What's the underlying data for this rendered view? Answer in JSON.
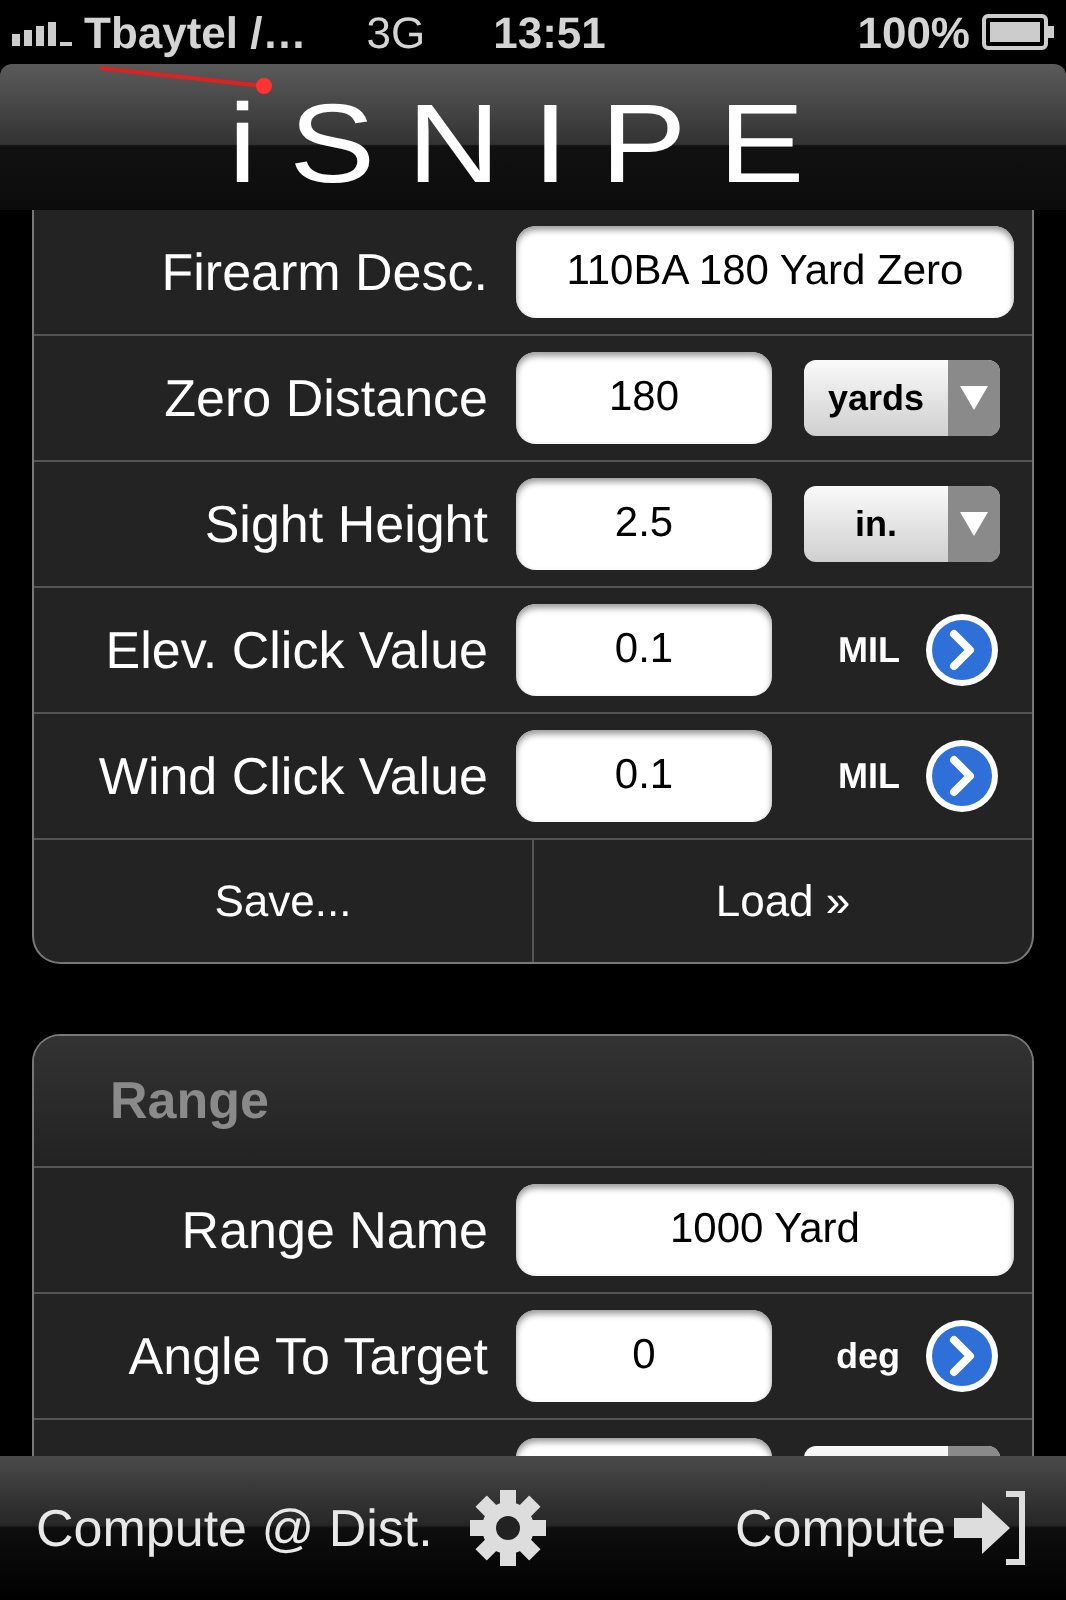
{
  "status_bar": {
    "carrier": "Tbaytel /…",
    "network": "3G",
    "time": "13:51",
    "battery": "100%"
  },
  "title_bar": {
    "logo": "iSNIPE"
  },
  "firearm": {
    "rows": [
      {
        "kind": "text",
        "label": "Firearm Desc.",
        "value": "110BA 180 Yard Zero"
      },
      {
        "kind": "select",
        "label": "Zero Distance",
        "value": "180",
        "unit": "yards"
      },
      {
        "kind": "select",
        "label": "Sight Height",
        "value": "2.5",
        "unit": "in."
      },
      {
        "kind": "detail",
        "label": "Elev. Click Value",
        "value": "0.1",
        "unit": "MIL"
      },
      {
        "kind": "detail",
        "label": "Wind Click Value",
        "value": "0.1",
        "unit": "MIL"
      }
    ],
    "actions": [
      "Save...",
      "Load »"
    ]
  },
  "range": {
    "title": "Range",
    "rows": [
      {
        "kind": "text",
        "label": "Range Name",
        "value": "1000 Yard"
      },
      {
        "kind": "detail",
        "label": "Angle To Target",
        "value": "0",
        "unit": "deg"
      },
      {
        "kind": "select"
      }
    ]
  },
  "toolbar": {
    "left": "Compute @ Dist.",
    "right": "Compute"
  }
}
